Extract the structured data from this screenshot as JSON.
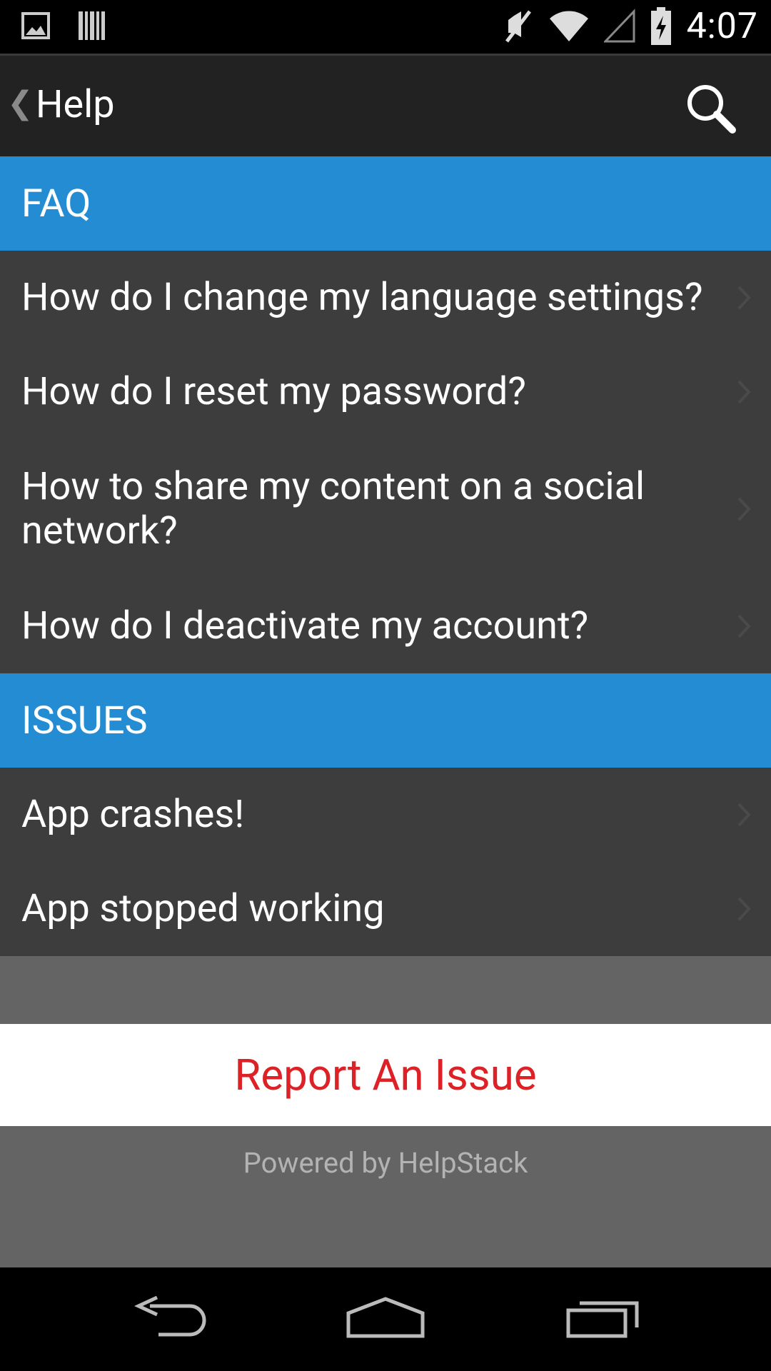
{
  "status_bar": {
    "time": "4:07",
    "left_icons": [
      "gallery-icon",
      "barcode-icon"
    ],
    "right_icons": [
      "mute-icon",
      "wifi-icon",
      "signal-icon",
      "battery-charging-icon"
    ]
  },
  "action_bar": {
    "title": "Help",
    "back_icon": "chevron-left-icon",
    "search_icon": "search-icon"
  },
  "sections": [
    {
      "header": "FAQ",
      "items": [
        "How do I change my language settings?",
        "How do I reset my password?",
        "How to share my content on a social network?",
        "How do I deactivate my account?"
      ]
    },
    {
      "header": "ISSUES",
      "items": [
        "App crashes!",
        "App stopped working"
      ]
    }
  ],
  "report_button": "Report An Issue",
  "footer": {
    "powered_by": "Powered by HelpStack"
  },
  "colors": {
    "section_header": "#238cd3",
    "list_bg": "#3d3d3d",
    "report_text": "#dd2227"
  },
  "nav_bar": [
    "back-icon",
    "home-icon",
    "recent-apps-icon"
  ]
}
